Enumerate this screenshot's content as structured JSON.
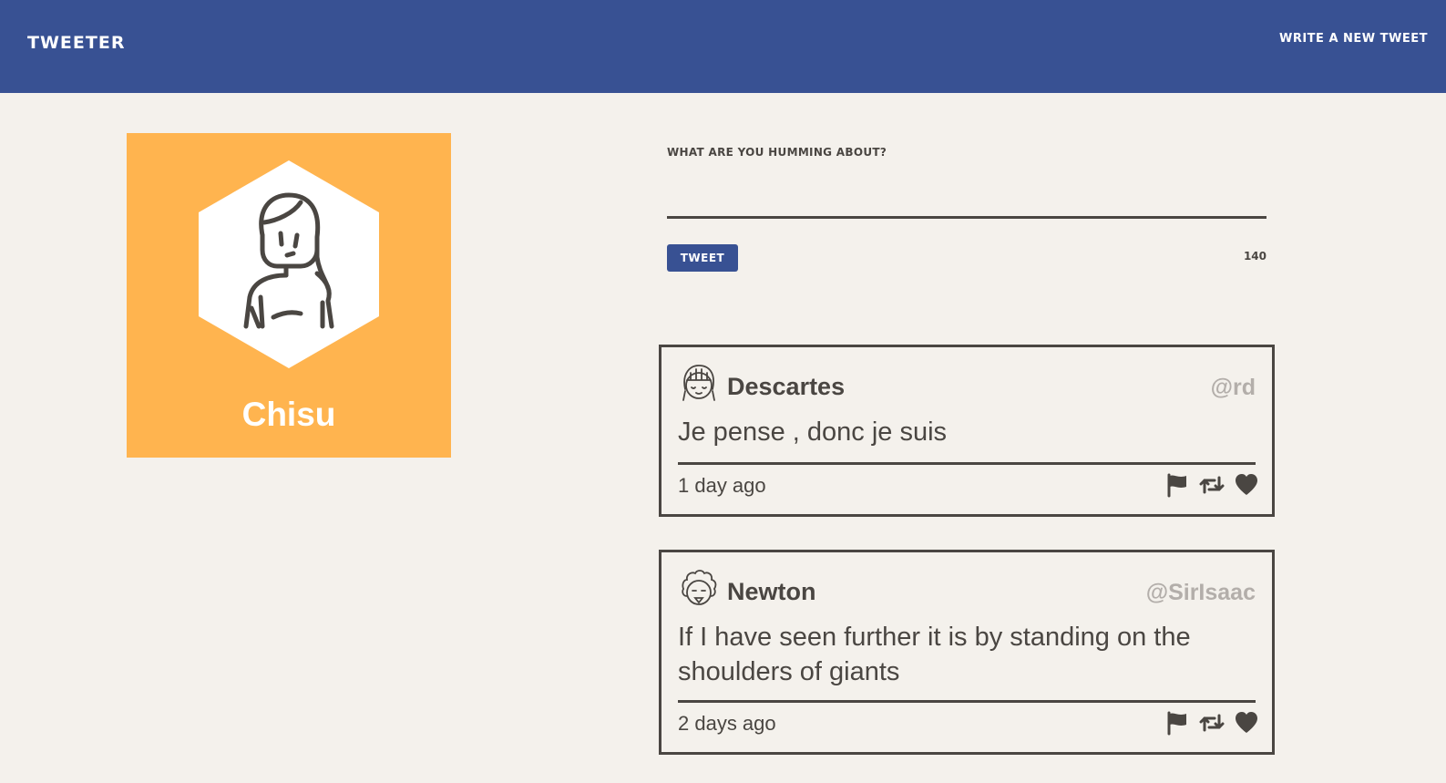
{
  "nav": {
    "brand": "Tweeter",
    "write_link": "Write a new tweet"
  },
  "profile": {
    "name": "Chisu",
    "card_color": "#ffb44f",
    "avatar_icon": "woman-avatar-icon"
  },
  "composer": {
    "label": "What are you humming about?",
    "input_value": "",
    "button_label": "Tweet",
    "counter": "140"
  },
  "tweets": [
    {
      "author": "Descartes",
      "handle": "@rd",
      "text": "Je pense , donc je suis",
      "time": "1 day ago",
      "avatar_icon": "girl-avatar-icon"
    },
    {
      "author": "Newton",
      "handle": "@SirIsaac",
      "text": "If I have seen further it is by standing on the shoulders of giants",
      "time": "2 days ago",
      "avatar_icon": "curly-hair-avatar-icon"
    }
  ],
  "colors": {
    "navbar": "#385193",
    "background": "#f4f1ec",
    "text": "#4a4642",
    "handle": "#b3aeaa"
  }
}
